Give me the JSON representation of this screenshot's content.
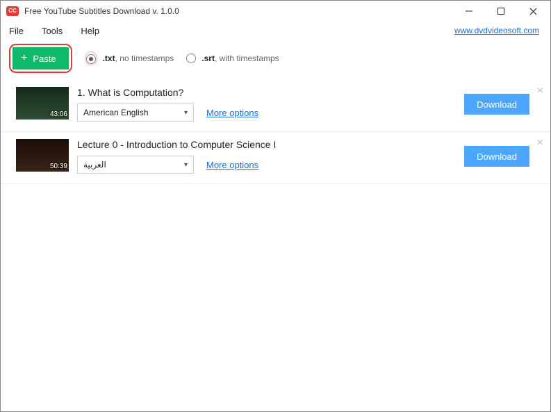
{
  "window": {
    "title": "Free YouTube Subtitles Download v. 1.0.0"
  },
  "menu": {
    "file": "File",
    "tools": "Tools",
    "help": "Help",
    "site_link": "www.dvdvideosoft.com"
  },
  "toolbar": {
    "paste_label": "Paste",
    "opt_txt_bold": ".txt",
    "opt_txt_rest": ", no timestamps",
    "opt_srt_bold": ".srt",
    "opt_srt_rest": ", with timestamps"
  },
  "items": [
    {
      "title": "1. What is Computation?",
      "duration": "43:06",
      "language": "American English",
      "more": "More options",
      "download": "Download"
    },
    {
      "title": "Lecture 0 - Introduction to Computer Science I",
      "duration": "50:39",
      "language": "العربية",
      "more": "More options",
      "download": "Download"
    }
  ]
}
